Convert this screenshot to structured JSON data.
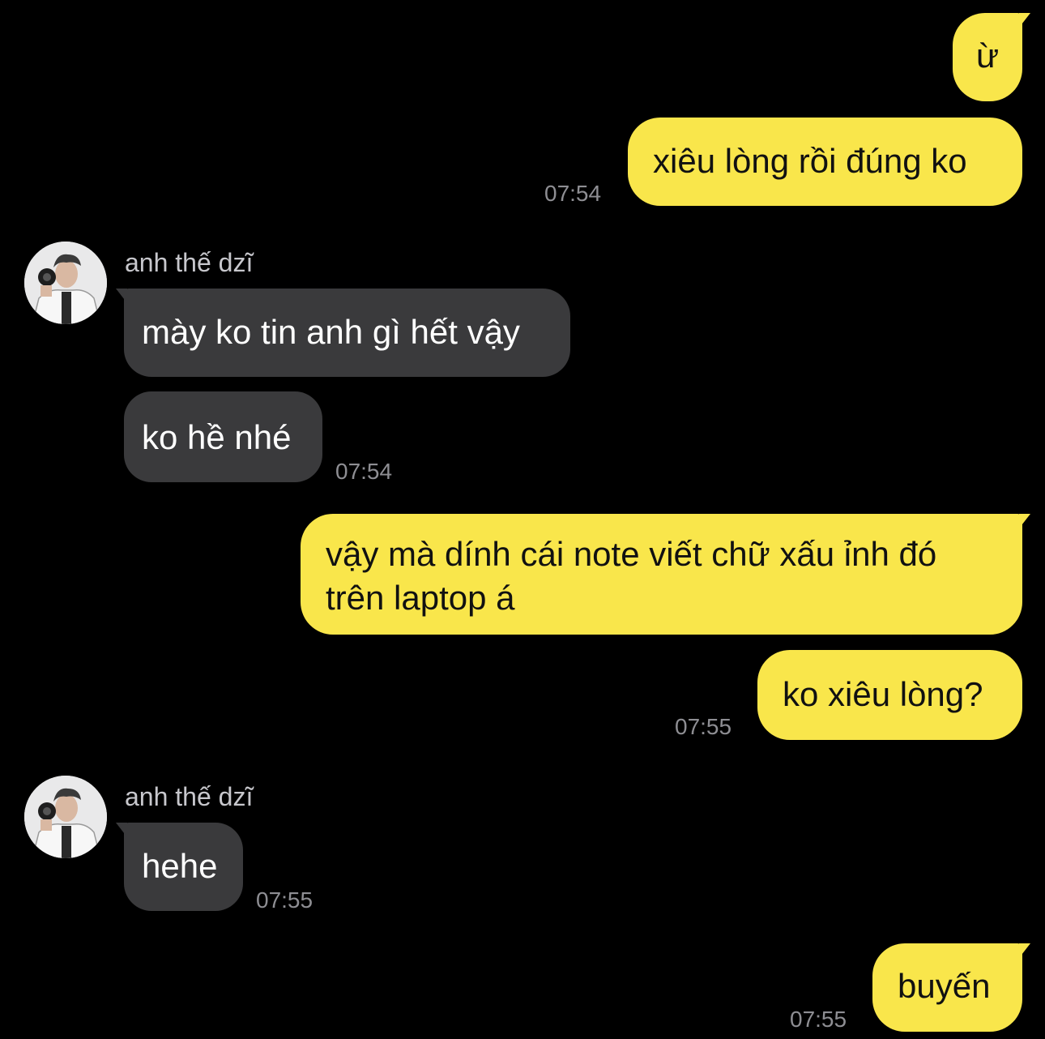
{
  "messages": {
    "m1": {
      "text": "ừ"
    },
    "m2": {
      "text": "xiêu lòng rồi đúng ko",
      "time": "07:54"
    },
    "m3": {
      "sender": "anh thế dzĩ",
      "text": "mày ko tin anh gì hết vậy"
    },
    "m4": {
      "text": "ko hề nhé",
      "time": "07:54"
    },
    "m5": {
      "line1": "vậy mà dính cái note viết chữ xấu ỉnh đó",
      "line2": "trên laptop á"
    },
    "m6": {
      "text": "ko xiêu lòng?",
      "time": "07:55"
    },
    "m7": {
      "sender": "anh thế dzĩ",
      "text": "hehe",
      "time": "07:55"
    },
    "m8": {
      "text": "buyến",
      "time": "07:55"
    }
  },
  "colors": {
    "background": "#000000",
    "outgoing_bubble": "#f9e64b",
    "incoming_bubble": "#3a3a3c",
    "timestamp": "#8e8e93"
  },
  "icons": {
    "avatar": "contact-avatar-photo"
  }
}
